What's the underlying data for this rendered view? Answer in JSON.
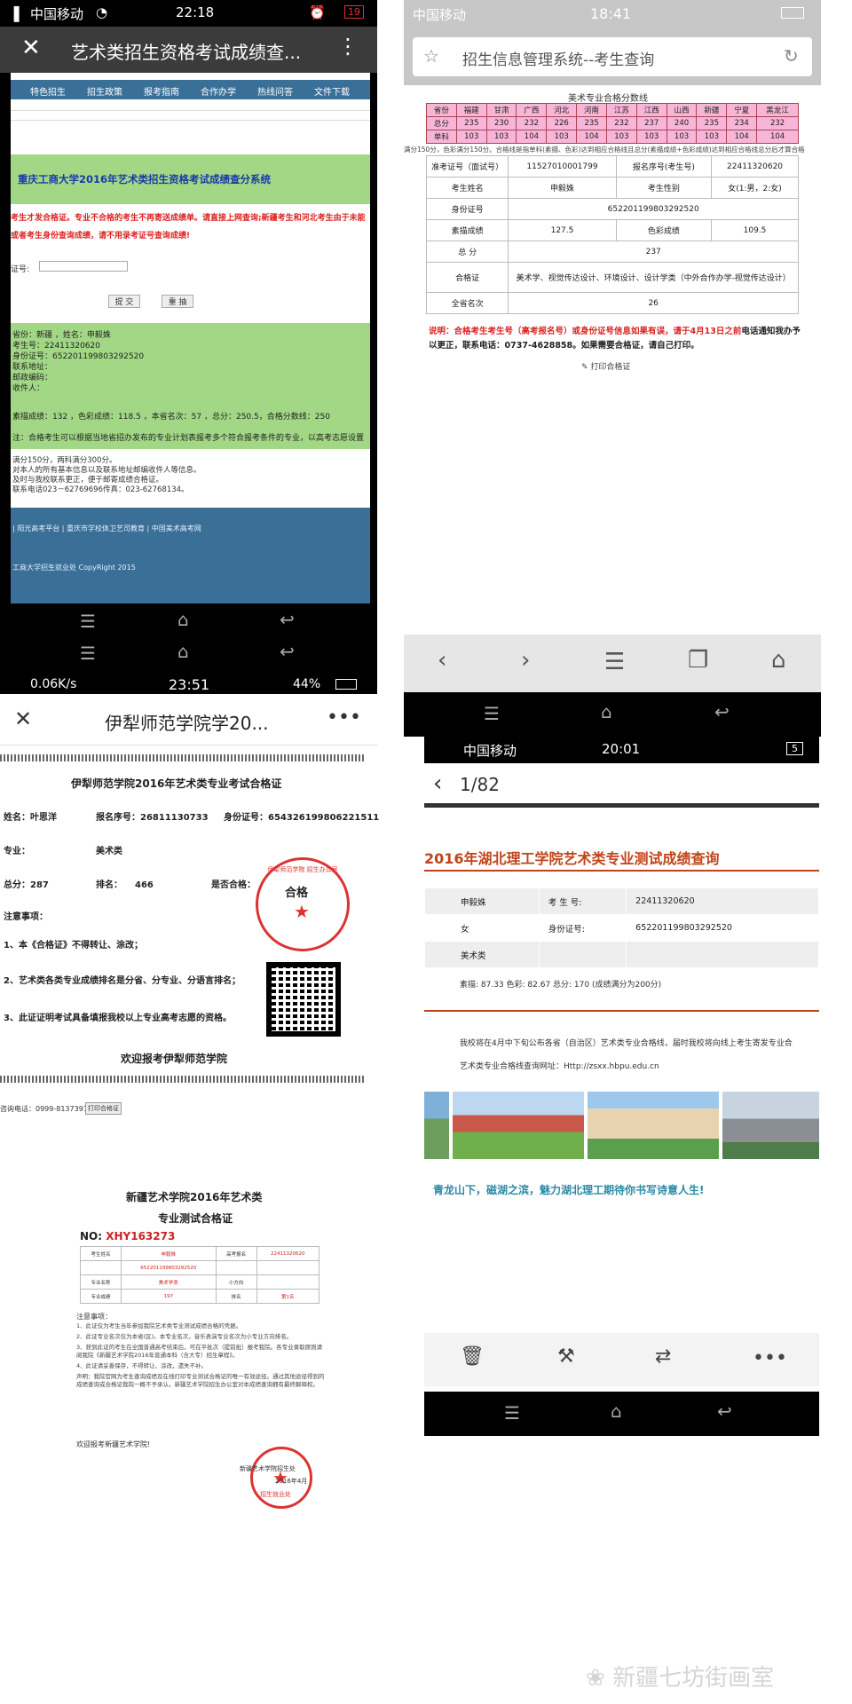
{
  "p1": {
    "status": {
      "carrier": "中国移动",
      "time": "22:18",
      "battery": "19"
    },
    "title": "艺术类招生资格考试成绩查...",
    "nav": [
      "",
      "特色招生",
      "招生政策",
      "报考指南",
      "合作办学",
      "热线问答",
      "文件下载"
    ],
    "heading": "重庆工商大学2016年艺术类招生资格考试成绩查分系统",
    "notice1": "考生才发合格证。专业不合格的考生不再寄送成绩单。请直接上网查询;新疆考生和河北考生由于未能",
    "notice2": "或者考生身份查询成绩，请不用录考证号查询成绩!",
    "idlabel": "证号:",
    "submit": "提 交",
    "reset": "重 抽",
    "info": [
      "省份：新疆    ，姓名：申毅姝",
      "考生号：22411320620",
      "身份证号：652201199803292520",
      "联系地址：",
      "邮政编码：",
      "收件人："
    ],
    "scores": "素描成绩：132   ，色彩成绩：118.5   ，本省名次：57   ，总分：250.5，合格分数线：250",
    "note": "注：合格考生可以根据当地省招办发布的专业计划表报考多个符合报考条件的专业，以高考志愿设置",
    "foot": [
      "满分150分，两科满分300分。",
      "对本人的所有基本信息以及联系地址邮编收件人等信息。",
      "及时与我校联系更正，便于邮寄成绩合格证。",
      "联系电话023－62769696传真：023-62768134。"
    ],
    "links": "| 阳光高考平台 | 重庆市学校体卫艺司教育 | 中国美术高考网",
    "copy": "工商大学招生就业处 CopyRight 2015"
  },
  "p2": {
    "status": {
      "carrier": "中国移动",
      "time": "18:41"
    },
    "urlbar": "招生信息管理系统--考生查询",
    "table_title": "美术专业合格分数线",
    "line_rows": [
      [
        "省份",
        "福建",
        "甘肃",
        "广西",
        "河北",
        "河南",
        "江苏",
        "江西",
        "山西",
        "新疆",
        "宁夏",
        "黑龙江"
      ],
      [
        "总分",
        "235",
        "230",
        "232",
        "226",
        "235",
        "232",
        "237",
        "240",
        "235",
        "234",
        "232"
      ],
      [
        "单科",
        "103",
        "103",
        "104",
        "103",
        "104",
        "103",
        "103",
        "103",
        "103",
        "104",
        "104"
      ]
    ],
    "line_note": "满分150分，色彩满分150分。合格线是指单科(素描、色彩)达到相应合格线且总分(素描成绩+色彩成绩)达到相应合格线总分后才算合格",
    "rows": [
      [
        "准考证号（面试号）",
        "11527010001799",
        "报名序号(考生号)",
        "22411320620"
      ],
      [
        "考生姓名",
        "申毅姝",
        "考生性别",
        "女(1:男，2:女)"
      ],
      [
        "身份证号",
        "652201199803292520"
      ],
      [
        "素描成绩",
        "127.5",
        "色彩成绩",
        "109.5"
      ],
      [
        "总  分",
        "237"
      ],
      [
        "合格证",
        "美术学、视觉传达设计、环境设计、设计学类（中外合作办学-视觉传达设计）"
      ],
      [
        "全省名次",
        "26"
      ]
    ],
    "explain_a": "说明：",
    "explain_b": "合格考生考生号（高考报名号）或身份证号信息如果有误，请于4月13日之前",
    "explain_c": "电话通知我办予以更正，联系电话：0737-4628858。如果需要合格证，请自己打印。",
    "print": "打印合格证"
  },
  "p3": {
    "status": {
      "speed": "0.06K/s",
      "time": "23:51",
      "battery": "44%"
    },
    "title": "伊犁师范学院学20...",
    "cert_title": "伊犁师范学院2016年艺术类专业考试合格证",
    "name": "姓名：叶思洋",
    "regno": "报名序号：26811130733",
    "idno": "身份证号：654326199806221511",
    "major": "专业：",
    "major_val": "美术类",
    "total": "总分：287",
    "rank": "排名：",
    "rank_val": "466",
    "pass": "是否合格：",
    "notes_title": "注意事项：",
    "notes": [
      "1、本《合格证》不得转让、涂改；",
      "2、艺术类各类专业成绩排名是分省、分专业、分语言排名；",
      "3、此证证明考试具备填报我校以上专业高考志愿的资格。"
    ],
    "welcome": "欢迎报考伊犁师范学院",
    "phone": "咨询电话：0999-8137391",
    "print": "打印合格证",
    "seal_text": "合格",
    "seal_ring": "伊犁师范学院 招生办公室"
  },
  "p4": {
    "title1": "新疆艺术学院2016年艺术类",
    "title2": "专业测试合格证",
    "no_label": "NO:",
    "no_val": "XHY163273",
    "grid": [
      [
        "考生姓名",
        "申毅姝",
        "高考报名",
        "22411320620"
      ],
      [
        "",
        "652201199803292520",
        "",
        ""
      ],
      [
        "专业名称",
        "美术学类",
        "小方向",
        ""
      ],
      [
        "专业成绩",
        "197",
        "排名",
        "第1名"
      ]
    ],
    "notes_title": "注意事项：",
    "notes": [
      "1、此证仅为考生当年参加我院艺术类专业测试成绩合格的凭据。",
      "2、此证专业名次仅为本省(区)。本专业名次，音乐表演专业名次为小专业方向排名。",
      "3、获到此证的考生在全国普通高考结束后，可在平批次（提前批）报考我院。各专业录取原则请阅我院《新疆艺术学院2016年普通本科（含大专）招生章程》。",
      "4、此证请妥善保存，不得转让、涂改，遗失不补。",
      "声明：我院官网为考生查询成绩及在线打印专业测试合格证的唯一有效途径。通过其他途径得到的成绩查询或合格证我院一概不予承认，新疆艺术学院招生办公室对本成绩查询拥有最终解释权。"
    ],
    "welcome": "欢迎报考新疆艺术学院!",
    "office": "新疆艺术学院招生处",
    "date": "2016年4月",
    "seal_text": "招生就业处"
  },
  "p5": {
    "status": {
      "carrier": "中国移动",
      "time": "20:01",
      "battery": "5"
    },
    "page": "1/82",
    "heading": "2016年湖北理工学院艺术类专业测试成绩查询",
    "rows": [
      [
        "申毅姝",
        "考 生 号:",
        "22411320620"
      ],
      [
        "女",
        "身份证号:",
        "652201199803292520"
      ],
      [
        "美术类",
        "",
        ""
      ]
    ],
    "scores": "素描: 87.33   色彩: 82.67   总分: 170      (成绩满分为200分)",
    "notice": "我校将在4月中下旬公布各省（自治区）艺术类专业合格线，届时我校将向线上考生寄发专业合",
    "notice2": "艺术类专业合格线查询网址：Http://zsxx.hbpu.edu.cn",
    "slogan": "青龙山下，磁湖之滨，魅力湖北理工期待你书写诗意人生!"
  },
  "watermark": "新疆七坊街画室",
  "colors": {
    "p1_nav": "#3a6f98",
    "p1_green": "#a2d885",
    "p2_pink": "#f7b5d8",
    "p5_orange": "#c0441a",
    "p5_slogan": "#2a8aa6"
  }
}
